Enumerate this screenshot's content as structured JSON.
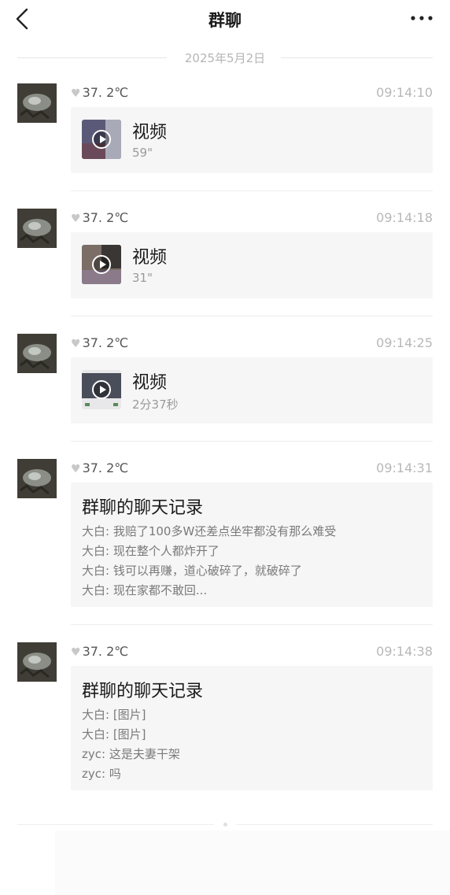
{
  "header": {
    "title": "群聊",
    "back_icon": "chevron-left-icon",
    "more_icon": "more-dots-icon"
  },
  "date_separator": "2025年5月2日",
  "messages": [
    {
      "sender": "37. 2℃",
      "time": "09:14:10",
      "type": "video",
      "title": "视频",
      "duration": "59\""
    },
    {
      "sender": "37. 2℃",
      "time": "09:14:18",
      "type": "video",
      "title": "视频",
      "duration": "31\""
    },
    {
      "sender": "37. 2℃",
      "time": "09:14:25",
      "type": "video",
      "title": "视频",
      "duration": "2分37秒"
    },
    {
      "sender": "37. 2℃",
      "time": "09:14:31",
      "type": "record",
      "title": "群聊的聊天记录",
      "lines": [
        "大白: 我赔了100多W还差点坐牢都没有那么难受",
        "大白: 现在整个人都炸开了",
        "大白: 钱可以再赚，道心破碎了，就破碎了",
        "大白: 现在家都不敢回..."
      ]
    },
    {
      "sender": "37. 2℃",
      "time": "09:14:38",
      "type": "record",
      "title": "群聊的聊天记录",
      "lines": [
        "大白: [图片]",
        "大白: [图片]",
        "zyc: 这是夫妻干架",
        "zyc: 吗"
      ]
    }
  ]
}
